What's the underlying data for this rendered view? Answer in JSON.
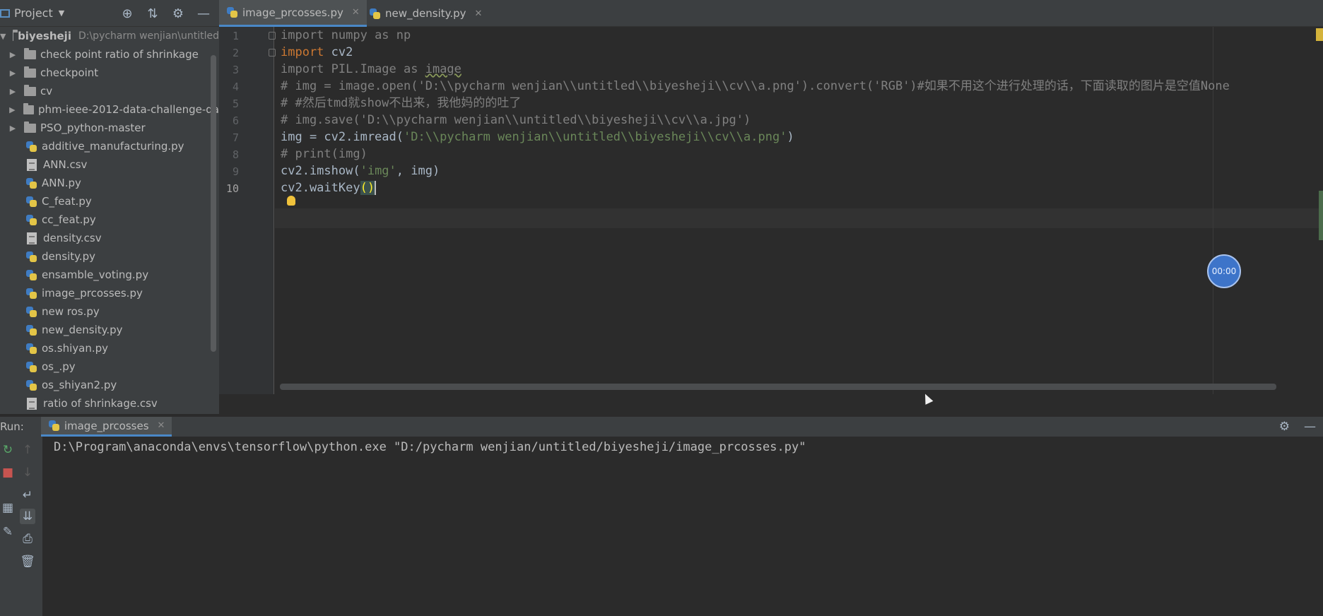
{
  "project_panel": {
    "title": "Project",
    "root": {
      "name": "biyesheji",
      "path": "D:\\pycharm wenjian\\untitled"
    },
    "folders": [
      "check point ratio of shrinkage",
      "checkpoint",
      "cv",
      "phm-ieee-2012-data-challenge-da",
      "PSO_python-master"
    ],
    "files": [
      {
        "name": "additive_manufacturing.py",
        "type": "py"
      },
      {
        "name": "ANN.csv",
        "type": "csv"
      },
      {
        "name": "ANN.py",
        "type": "py"
      },
      {
        "name": "C_feat.py",
        "type": "py"
      },
      {
        "name": "cc_feat.py",
        "type": "py"
      },
      {
        "name": "density.csv",
        "type": "csv"
      },
      {
        "name": "density.py",
        "type": "py"
      },
      {
        "name": "ensamble_voting.py",
        "type": "py"
      },
      {
        "name": "image_prcosses.py",
        "type": "py"
      },
      {
        "name": "new ros.py",
        "type": "py"
      },
      {
        "name": "new_density.py",
        "type": "py"
      },
      {
        "name": "os.shiyan.py",
        "type": "py"
      },
      {
        "name": "os_.py",
        "type": "py"
      },
      {
        "name": "os_shiyan2.py",
        "type": "py"
      },
      {
        "name": "ratio of shrinkage.csv",
        "type": "csv"
      }
    ]
  },
  "editor": {
    "tabs": [
      {
        "label": "image_prcosses.py",
        "active": true
      },
      {
        "label": "new_density.py",
        "active": false
      }
    ],
    "line_numbers": [
      "1",
      "2",
      "3",
      "4",
      "5",
      "6",
      "7",
      "8",
      "9",
      "10"
    ],
    "code": {
      "l1": {
        "kw": "import",
        "rest": " numpy as np"
      },
      "l2": {
        "kw": "import",
        "rest": " cv2"
      },
      "l3": {
        "kw": "import",
        "rest": " PIL.Image as ",
        "img": "image"
      },
      "l4": "# img = image.open('D:\\\\pycharm wenjian\\\\untitled\\\\biyesheji\\\\cv\\\\a.png').convert('RGB')#如果不用这个进行处理的话，下面读取的图片是空值None",
      "l5": "# #然后tmd就show不出来，我他妈的的吐了",
      "l6": "# img.save('D:\\\\pycharm wenjian\\\\untitled\\\\biyesheji\\\\cv\\\\a.jpg')",
      "l7": {
        "pre": "img = cv2.imread(",
        "str": "'D:\\\\pycharm wenjian\\\\untitled\\\\biyesheji\\\\cv\\\\a.png'",
        "post": ")"
      },
      "l8": "# print(img)",
      "l9": {
        "pre": "cv2.imshow(",
        "str": "'img'",
        "post": ", img)"
      },
      "l10": {
        "pre": "cv2.waitKey",
        "bracket": "()"
      }
    },
    "timer": "00:00"
  },
  "run_panel": {
    "label": "Run:",
    "tab": "image_prcosses",
    "output": "D:\\Program\\anaconda\\envs\\tensorflow\\python.exe \"D:/pycharm wenjian/untitled/biyesheji/image_prcosses.py\""
  },
  "colors": {
    "keyword": "#cc7832",
    "string": "#6a8759",
    "comment": "#808080",
    "accent": "#4a88c7"
  }
}
